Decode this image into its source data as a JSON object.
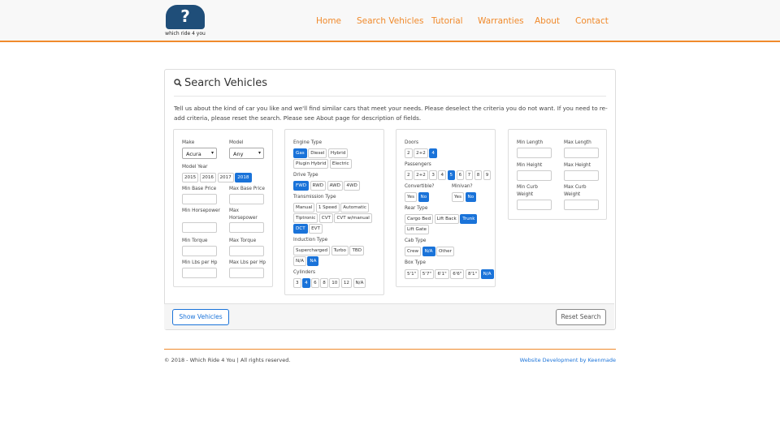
{
  "brand": {
    "logo_text": "which ride 4 you",
    "logo_glyph": "?"
  },
  "nav": {
    "items": [
      "Home",
      "Search Vehicles",
      "Tutorial",
      "Warranties",
      "About",
      "Contact"
    ]
  },
  "colors": {
    "accent": "#f08a2c",
    "selected": "#1a73d9",
    "logo": "#1f4e79"
  },
  "panel": {
    "title": "Search Vehicles",
    "title_icon": "search-icon",
    "intro": "Tell us about the kind of car you like and we'll find similar cars that meet your needs. Please deselect the criteria you do not want. If you need to re-add criteria, please reset the search. Please see About page for description of fields."
  },
  "col1": {
    "make_label": "Make",
    "make_value": "Acura",
    "model_label": "Model",
    "model_value": "Any",
    "year_label": "Model Year",
    "years": [
      "2015",
      "2016",
      "2017",
      "2018"
    ],
    "year_selected": [
      3
    ],
    "min_base_price": "Min Base Price",
    "max_base_price": "Max Base Price",
    "min_hp": "Min Horsepower",
    "max_hp": "Max Horsepower",
    "min_torque": "Min Torque",
    "max_torque": "Max Torque",
    "min_lbs_hp": "Min Lbs per Hp",
    "max_lbs_hp": "Max Lbs per Hp"
  },
  "col2": {
    "engine_label": "Engine Type",
    "engine_row1": [
      "Gas",
      "Diesel",
      "Hybrid"
    ],
    "engine_row2": [
      "Plugin Hybrid",
      "Electric"
    ],
    "drive_label": "Drive Type",
    "drive": [
      "FWD",
      "RWD",
      "AWD",
      "4WD"
    ],
    "trans_label": "Transmission Type",
    "trans_row1": [
      "Manual",
      "1 Speed",
      "Automatic"
    ],
    "trans_row2": [
      "Tiptronic",
      "CVT",
      "CVT w/manual"
    ],
    "trans_row3": [
      "DCT",
      "EVT"
    ],
    "induction_label": "Induction Type",
    "induction_row1": [
      "Supercharged",
      "Turbo",
      "TBD"
    ],
    "induction_row2": [
      "N/A",
      "NA"
    ],
    "cyl_label": "Cylinders",
    "cylinders": [
      "3",
      "4",
      "6",
      "8",
      "10",
      "12",
      "N/A"
    ]
  },
  "col3": {
    "doors_label": "Doors",
    "doors": [
      "2",
      "2+2",
      "4"
    ],
    "pass_label": "Passengers",
    "passengers": [
      "2",
      "2+2",
      "3",
      "4",
      "5",
      "6",
      "7",
      "8",
      "9"
    ],
    "conv_label": "Convertible?",
    "conv": [
      "Yes",
      "No"
    ],
    "minivan_label": "Minivan?",
    "minivan": [
      "Yes",
      "No"
    ],
    "rear_label": "Rear Type",
    "rear_row1": [
      "Cargo Bed",
      "Lift Back",
      "Trunk"
    ],
    "rear_row2": [
      "Lift Gate"
    ],
    "cab_label": "Cab Type",
    "cab": [
      "Crew",
      "N/A",
      "Other"
    ],
    "box_label": "Box Type",
    "box": [
      "5'1\"",
      "5'7\"",
      "6'1\"",
      "6'6\"",
      "8'1\"",
      "N/A"
    ]
  },
  "col4": {
    "min_length": "Min Length",
    "max_length": "Max Length",
    "min_height": "Min Height",
    "max_height": "Max Height",
    "min_curb": "Min Curb Weight",
    "max_curb": "Max Curb Weight"
  },
  "actions": {
    "show": "Show Vehicles",
    "reset": "Reset Search"
  },
  "footer": {
    "copyright": "© 2018 - Which Ride 4 You | All rights reserved.",
    "credit": "Website Development by Keenmade"
  }
}
